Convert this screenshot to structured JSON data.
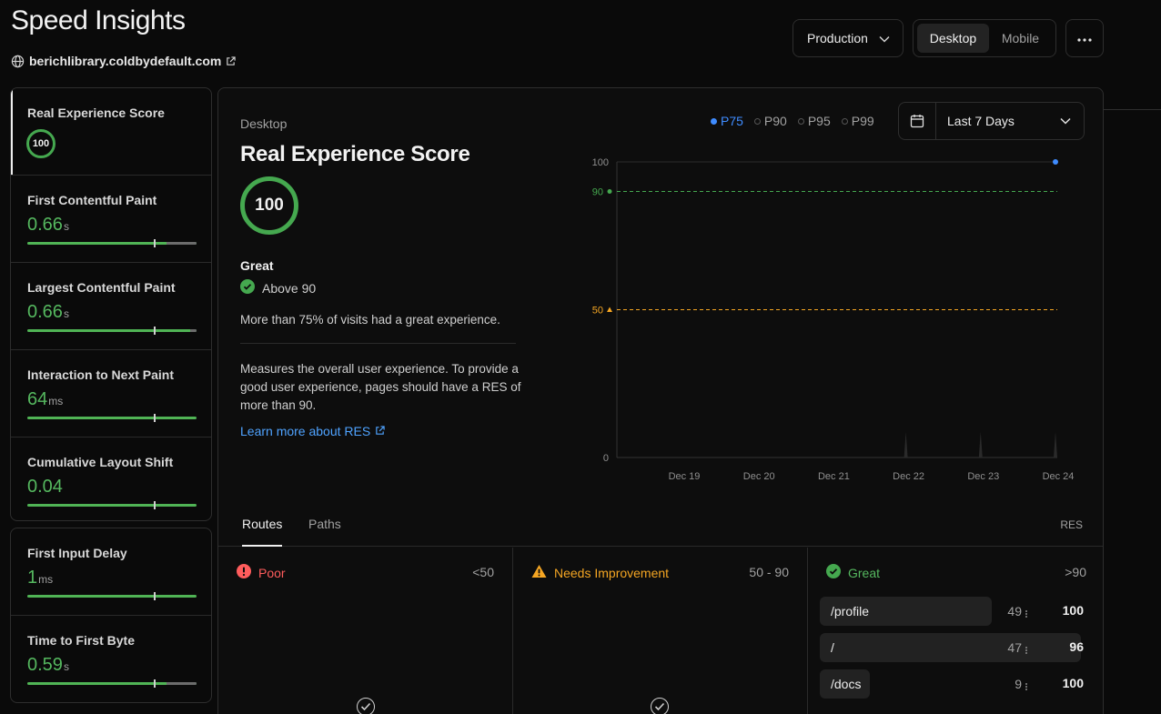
{
  "header": {
    "title": "Speed Insights",
    "site": "berichlibrary.coldbydefault.com",
    "environment": "Production",
    "devices": [
      "Desktop",
      "Mobile"
    ],
    "active_device": "Desktop"
  },
  "sidebar": {
    "metrics": [
      {
        "name": "Real Experience Score",
        "value": "100",
        "unit": ""
      },
      {
        "name": "First Contentful Paint",
        "value": "0.66",
        "unit": "s"
      },
      {
        "name": "Largest Contentful Paint",
        "value": "0.66",
        "unit": "s"
      },
      {
        "name": "Interaction to Next Paint",
        "value": "64",
        "unit": "ms"
      },
      {
        "name": "Cumulative Layout Shift",
        "value": "0.04",
        "unit": ""
      }
    ],
    "other_metrics": [
      {
        "name": "First Input Delay",
        "value": "1",
        "unit": "ms"
      },
      {
        "name": "Time to First Byte",
        "value": "0.59",
        "unit": "s"
      }
    ]
  },
  "main": {
    "device": "Desktop",
    "title": "Real Experience Score",
    "score": "100",
    "rating": "Great",
    "threshold": "Above 90",
    "summary": "More than 75% of visits had a great experience.",
    "description": "Measures the overall user experience. To provide a good user experience, pages should have a RES of more than 90.",
    "learn_more": "Learn more about RES",
    "percentiles": [
      "P75",
      "P90",
      "P95",
      "P99"
    ],
    "active_percentile": "P75",
    "date_range": "Last 7 Days"
  },
  "chart_data": {
    "type": "line",
    "x": [
      "Dec 19",
      "Dec 20",
      "Dec 21",
      "Dec 22",
      "Dec 23",
      "Dec 24"
    ],
    "series": [
      {
        "values": [
          null,
          null,
          null,
          null,
          null,
          100
        ]
      }
    ],
    "ylim": [
      0,
      100
    ],
    "yticks": [
      "100",
      "90",
      "50",
      "0"
    ],
    "thresholds": [
      {
        "label": "90",
        "value": 90,
        "color": "#45a84f"
      },
      {
        "label": "50",
        "value": 50,
        "color": "#f5a623"
      }
    ]
  },
  "routes": {
    "tabs": [
      "Routes",
      "Paths"
    ],
    "active_tab": "Routes",
    "column_label": "RES",
    "categories": [
      {
        "name": "Poor",
        "range": "<50",
        "color": "#ff5c5c"
      },
      {
        "name": "Needs Improvement",
        "range": "50 - 90",
        "color": "#f5a623"
      },
      {
        "name": "Great",
        "range": ">90",
        "color": "#55b85f"
      }
    ],
    "great_rows": [
      {
        "route": "/profile",
        "count": "49",
        "score": "100"
      },
      {
        "route": "/",
        "count": "47",
        "score": "96"
      },
      {
        "route": "/docs",
        "count": "9",
        "score": "100"
      }
    ]
  }
}
